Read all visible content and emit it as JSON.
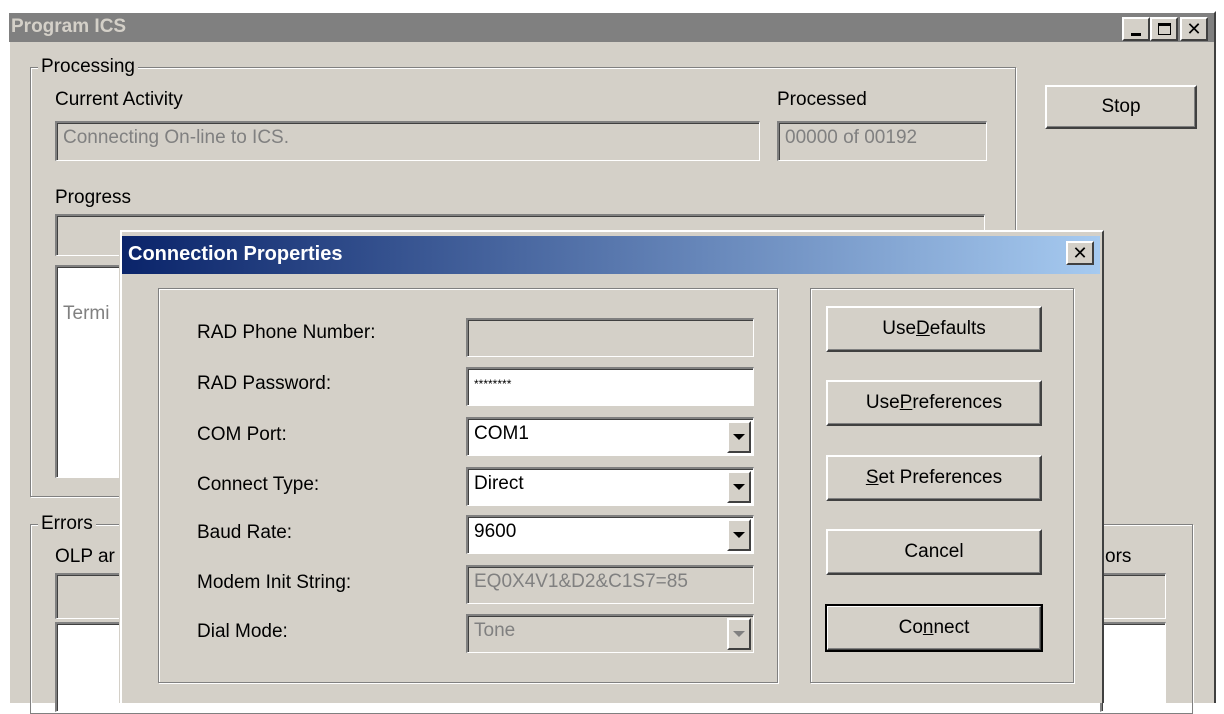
{
  "outer_window": {
    "title": "Program ICS",
    "processing": {
      "group_label": "Processing",
      "current_activity_label": "Current Activity",
      "current_activity_value": "Connecting On-line to ICS.",
      "processed_label": "Processed",
      "processed_value": "00000 of 00192",
      "progress_label": "Progress",
      "log_text_partial": "Termi"
    },
    "stop_button": "Stop",
    "errors": {
      "group_label": "Errors",
      "left_label_partial": "OLP ar",
      "right_label_partial": "ors"
    }
  },
  "dialog": {
    "title": "Connection Properties",
    "fields": {
      "rad_phone_label": "RAD Phone Number:",
      "rad_phone_value": "",
      "rad_password_label": "RAD Password:",
      "rad_password_value": "********",
      "com_port_label": "COM Port:",
      "com_port_value": "COM1",
      "connect_type_label": "Connect Type:",
      "connect_type_value": "Direct",
      "baud_rate_label": "Baud Rate:",
      "baud_rate_value": "9600",
      "modem_init_label": "Modem Init String:",
      "modem_init_value": "EQ0X4V1&D2&C1S7=85",
      "dial_mode_label": "Dial Mode:",
      "dial_mode_value": "Tone"
    },
    "buttons": {
      "use_defaults_pre": "Use ",
      "use_defaults_key": "D",
      "use_defaults_post": "efaults",
      "use_preferences_pre": "Use ",
      "use_preferences_key": "P",
      "use_preferences_post": "references",
      "set_preferences_pre": "",
      "set_preferences_key": "S",
      "set_preferences_post": "et Preferences",
      "cancel": "Cancel",
      "connect_pre": "Co",
      "connect_key": "n",
      "connect_post": "nect"
    }
  }
}
